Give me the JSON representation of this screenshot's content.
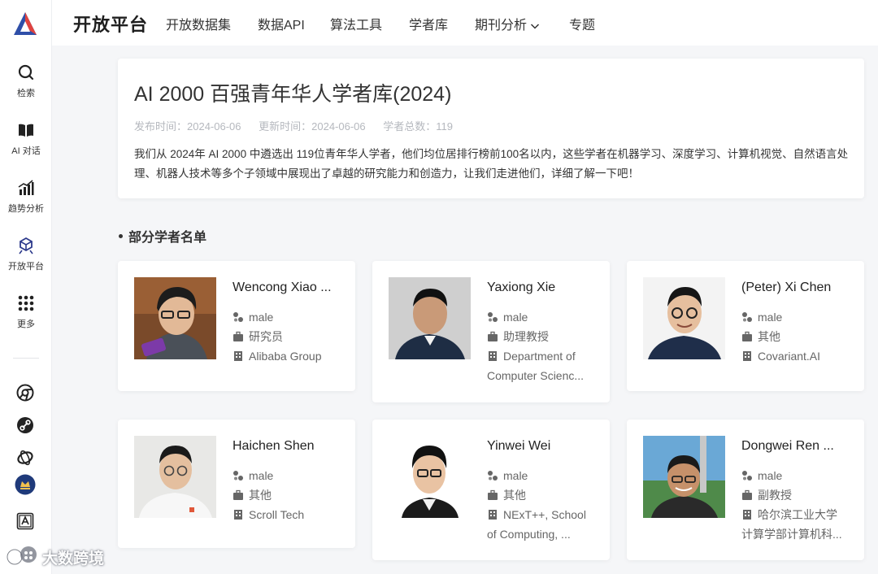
{
  "sidebar": {
    "items": [
      {
        "label": "检索",
        "icon": "search-icon"
      },
      {
        "label": "AI 对话",
        "icon": "book-icon"
      },
      {
        "label": "趋势分析",
        "icon": "bar-chart-icon"
      },
      {
        "label": "开放平台",
        "icon": "platform-icon"
      },
      {
        "label": "更多",
        "icon": "grid-icon"
      }
    ],
    "apps": [
      "chrome-icon",
      "link-icon",
      "ring-icon",
      "badge-icon",
      "translate-icon"
    ]
  },
  "watermark": {
    "text": "大数跨境"
  },
  "nav": {
    "brand": "开放平台",
    "items": [
      "开放数据集",
      "数据API",
      "算法工具",
      "学者库",
      "期刊分析",
      "专题"
    ]
  },
  "header": {
    "title": "AI 2000 百强青年华人学者库(2024)",
    "publish": "发布时间：2024-06-06",
    "update": "更新时间：2024-06-06",
    "total": "学者总数：119",
    "description": "我们从 2024年 AI 2000 中遴选出 119位青年华人学者，他们均位居排行榜前100名以内，这些学者在机器学习、深度学习、计算机视觉、自然语言处理、机器人技术等多个子领域中展现出了卓越的研究能力和创造力，让我们走进他们，详细了解一下吧！"
  },
  "section": {
    "title": "部分学者名单"
  },
  "scholars": [
    {
      "name": "Wencong Xiao ...",
      "gender": "male",
      "title": "研究员",
      "aff1": "Alibaba Group",
      "aff2": ""
    },
    {
      "name": "Yaxiong Xie",
      "gender": "male",
      "title": "助理教授",
      "aff1": "Department of",
      "aff2": "Computer Scienc..."
    },
    {
      "name": "(Peter) Xi Chen",
      "gender": "male",
      "title": "其他",
      "aff1": "Covariant.AI",
      "aff2": ""
    },
    {
      "name": "Haichen Shen",
      "gender": "male",
      "title": "其他",
      "aff1": "Scroll Tech",
      "aff2": ""
    },
    {
      "name": "Yinwei Wei",
      "gender": "male",
      "title": "其他",
      "aff1": "NExT++, School",
      "aff2": "of Computing, ..."
    },
    {
      "name": "Dongwei Ren ...",
      "gender": "male",
      "title": "副教授",
      "aff1": "哈尔滨工业大学",
      "aff2": "计算学部计算机科..."
    }
  ]
}
